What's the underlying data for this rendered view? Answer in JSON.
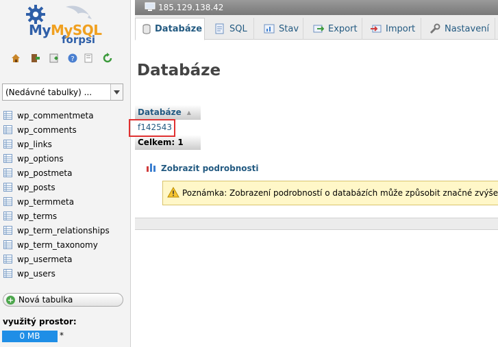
{
  "sidebar": {
    "logo_text_top": "MySQL",
    "logo_text_bottom": "forpsi",
    "toolbar_icons": [
      "home-icon",
      "logout-icon",
      "query-window-icon",
      "docs-icon",
      "sql-docs-icon",
      "reload-icon"
    ],
    "recent_tables": "(Nedávné tabulky) ...",
    "tables": [
      "wp_commentmeta",
      "wp_comments",
      "wp_links",
      "wp_options",
      "wp_postmeta",
      "wp_posts",
      "wp_termmeta",
      "wp_terms",
      "wp_term_relationships",
      "wp_term_taxonomy",
      "wp_usermeta",
      "wp_users"
    ],
    "new_table": "Nová tabulka",
    "space_label": "využitý prostor:",
    "space_value": "0 MB",
    "space_note": "*"
  },
  "topbar": {
    "server": "185.129.138.42"
  },
  "tabs": [
    {
      "label": "Databáze",
      "icon": "database-icon"
    },
    {
      "label": "SQL",
      "icon": "sql-icon"
    },
    {
      "label": "Stav",
      "icon": "status-icon"
    },
    {
      "label": "Export",
      "icon": "export-icon"
    },
    {
      "label": "Import",
      "icon": "import-icon"
    },
    {
      "label": "Nastavení",
      "icon": "settings-icon"
    }
  ],
  "main": {
    "title": "Databáze",
    "table_header": "Databáze",
    "databases": [
      "f142543"
    ],
    "total": "Celkem: 1",
    "details_link": "Zobrazit podrobnosti",
    "notice": "Poznámka: Zobrazení podrobností o databázích může způsobit značné zvýšení"
  },
  "colors": {
    "link": "#235a81",
    "highlight": "#e03030",
    "space_bar": "#1f8ee6"
  }
}
